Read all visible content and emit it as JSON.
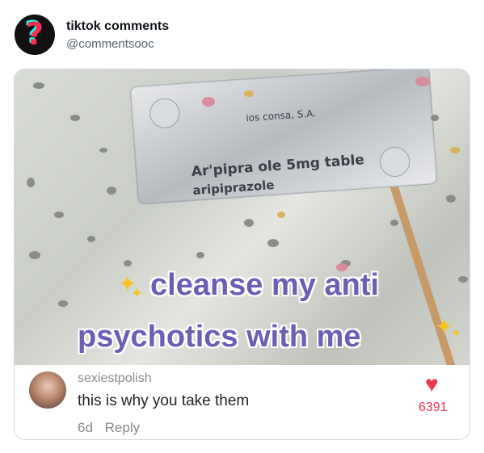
{
  "post": {
    "account_name": "tiktok comments",
    "handle": "@commentsooc",
    "avatar_icon": "question-mark-icon"
  },
  "video": {
    "caption_line1": "cleanse my anti",
    "caption_line2": "psychotics with me",
    "blister_text_1": "Ar'pipra ole 5mg table",
    "blister_text_2": "aripiprazole",
    "blister_text_3": "ios consa, S.A."
  },
  "comment": {
    "username": "sexiestpolish",
    "text": "this is why you take them",
    "age": "6d",
    "reply_label": "Reply",
    "like_count": "6391"
  },
  "colors": {
    "caption": "#6a5fb3",
    "heart": "#e8374f",
    "sparkle": "#f3c623"
  }
}
